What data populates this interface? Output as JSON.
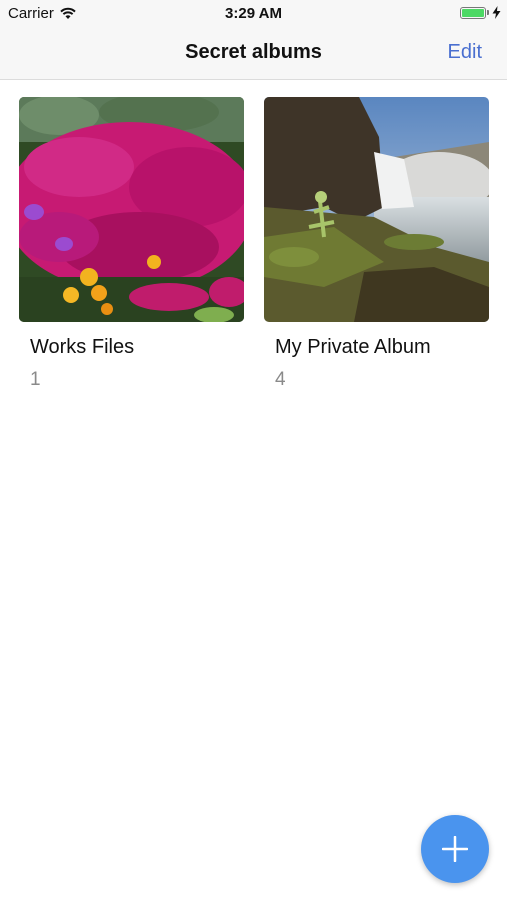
{
  "status_bar": {
    "carrier": "Carrier",
    "time": "3:29 AM",
    "battery_level": 1.0,
    "wifi_icon": "wifi-icon",
    "charging_icon": "bolt-icon"
  },
  "nav": {
    "title": "Secret albums",
    "edit_label": "Edit"
  },
  "albums": [
    {
      "name": "Works Files",
      "count": "1",
      "thumbnail": "pink-flowers-photo"
    },
    {
      "name": "My Private Album",
      "count": "4",
      "thumbnail": "waterfall-photo"
    }
  ],
  "fab": {
    "icon": "plus-icon"
  },
  "colors": {
    "accent": "#4a6fd0",
    "fab": "#4a94ee",
    "battery": "#4cd964"
  }
}
